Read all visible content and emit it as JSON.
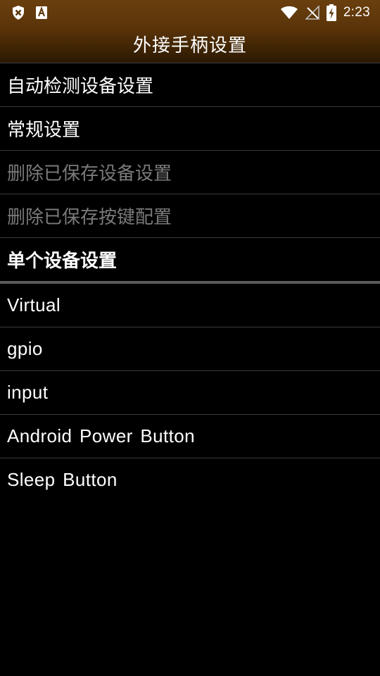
{
  "statusbar": {
    "time": "2:23",
    "left_icons": [
      "shield-icon",
      "app-a-icon"
    ],
    "right_icons": [
      "wifi-icon",
      "no-signal-icon",
      "battery-charging-icon"
    ]
  },
  "header": {
    "title": "外接手柄设置",
    "gradient_top": "#6a3f0e",
    "gradient_bottom": "#2a1803"
  },
  "settings": {
    "auto_detect": "自动检测设备设置",
    "general": "常规设置",
    "delete_saved_device": "删除已保存设备设置",
    "delete_saved_keys": "删除已保存按键配置",
    "single_device_header": "单个设备设置"
  },
  "devices": [
    {
      "label": "Virtual"
    },
    {
      "label": "gpio"
    },
    {
      "label": "input"
    },
    {
      "label": "Android Power Button"
    },
    {
      "label": "Sleep Button"
    }
  ]
}
